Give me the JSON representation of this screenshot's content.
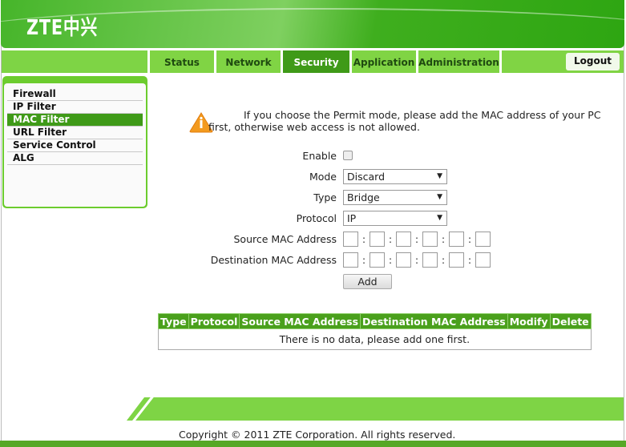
{
  "header": {
    "logo": "ZTE中兴"
  },
  "nav": {
    "tabs": [
      {
        "label": "Status"
      },
      {
        "label": "Network"
      },
      {
        "label": "Security",
        "active": true
      },
      {
        "label": "Application"
      },
      {
        "label": "Administration"
      }
    ],
    "logout": "Logout"
  },
  "sidebar": {
    "items": [
      {
        "label": "Firewall"
      },
      {
        "label": "IP Filter"
      },
      {
        "label": "MAC Filter",
        "active": true
      },
      {
        "label": "URL Filter"
      },
      {
        "label": "Service Control"
      },
      {
        "label": "ALG"
      }
    ]
  },
  "notice": {
    "icon": "warning-info-icon",
    "text": "If you choose the Permit mode, please add the MAC address of your PC first, otherwise web access is not allowed."
  },
  "form": {
    "enable_label": "Enable",
    "enable_checked": false,
    "mode_label": "Mode",
    "mode_value": "Discard",
    "type_label": "Type",
    "type_value": "Bridge",
    "protocol_label": "Protocol",
    "protocol_value": "IP",
    "src_mac_label": "Source MAC Address",
    "dst_mac_label": "Destination MAC Address",
    "separator": ":",
    "add_label": "Add"
  },
  "table": {
    "headers": [
      "Type",
      "Protocol",
      "Source MAC Address",
      "Destination MAC Address",
      "Modify",
      "Delete"
    ],
    "empty_text": "There is no data, please add one first."
  },
  "footer": {
    "copyright": "Copyright © 2011 ZTE Corporation. All rights reserved."
  },
  "colors": {
    "brand_green": "#4aa01c",
    "active_tab": "#3f9a18",
    "light_green": "#7ed445",
    "warning": "#f39a1e"
  }
}
